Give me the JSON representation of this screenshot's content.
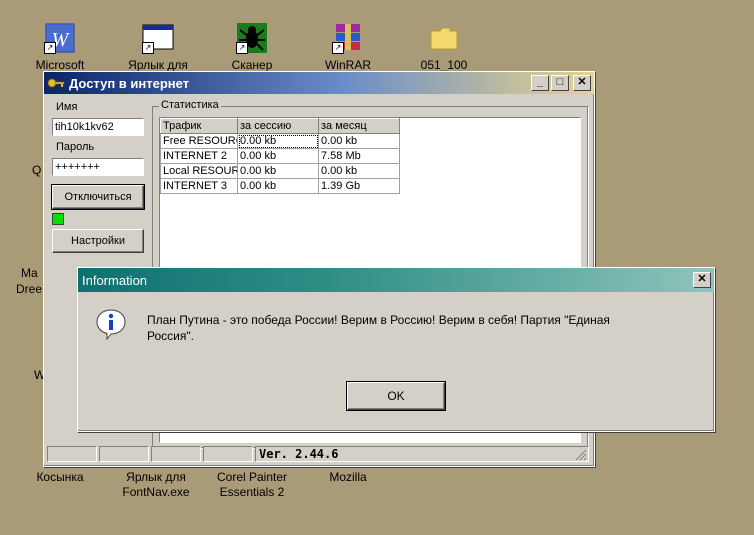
{
  "desktop": {
    "top_icons": [
      {
        "label": "Microsoft",
        "icon": "word-icon"
      },
      {
        "label": "Ярлык для",
        "icon": "shortcut-window-icon"
      },
      {
        "label": "Сканер",
        "icon": "scanner-spider-icon"
      },
      {
        "label": "WinRAR",
        "icon": "winrar-icon"
      },
      {
        "label": "051_100",
        "icon": "folder-icon"
      }
    ],
    "left_fragments": [
      "Q",
      "Ma",
      "Dree",
      "W"
    ],
    "bottom_icons": [
      {
        "label": "Косынка",
        "label2": ""
      },
      {
        "label": "Ярлык для",
        "label2": "FontNav.exe"
      },
      {
        "label": "Corel Painter",
        "label2": "Essentials 2"
      },
      {
        "label": "Mozilla",
        "label2": ""
      }
    ]
  },
  "app": {
    "title": "Доступ в интернет",
    "name_label": "Имя",
    "name_value": "tih10k1kv62",
    "password_label": "Пароль",
    "password_value": "+++++++",
    "disconnect_label": "Отключиться",
    "settings_label": "Настройки",
    "stats_group": "Статистика",
    "columns": [
      "Трафик",
      "за сессию",
      "за месяц"
    ],
    "rows": [
      [
        "Free RESOURCES",
        "0.00 kb",
        "0.00 kb"
      ],
      [
        "INTERNET 2",
        "0.00 kb",
        "7.58 Mb"
      ],
      [
        "Local RESOURCES",
        "0.00 kb",
        "0.00 kb"
      ],
      [
        "INTERNET 3",
        "0.00 kb",
        "1.39 Gb"
      ]
    ],
    "version": "Ver. 2.44.6",
    "status_color": "#00e000"
  },
  "dialog": {
    "title": "Information",
    "message_line1": "План Путина - это победа России! Верим в Россию! Верим в себя! Партия \"Единая",
    "message_line2": "Россия\".",
    "ok_label": "OK",
    "icon": "info-icon"
  }
}
